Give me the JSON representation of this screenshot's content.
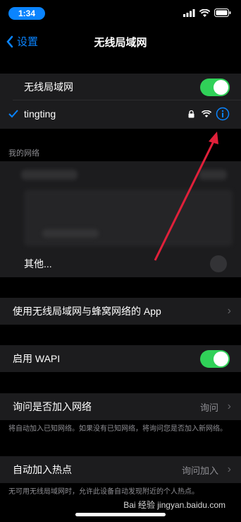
{
  "status_bar": {
    "time": "1:34"
  },
  "nav": {
    "back_label": "设置",
    "title": "无线局域网"
  },
  "wifi_group": {
    "toggle_label": "无线局域网",
    "connected_network": "tingting"
  },
  "my_networks": {
    "header": "我的网络",
    "other_label": "其他..."
  },
  "apps_row": {
    "label": "使用无线局域网与蜂窝网络的 App"
  },
  "wapi_row": {
    "label": "启用 WAPI"
  },
  "ask_join": {
    "label": "询问是否加入网络",
    "value": "询问",
    "footnote": "将自动加入已知网络。如果没有已知网络，将询问您是否加入新网络。"
  },
  "hotspot": {
    "label": "自动加入热点",
    "value": "询问加入",
    "footnote": "无可用无线局域网时，允许此设备自动发现附近的个人热点。"
  },
  "watermark": "Bai 经验 jingyan.baidu.com",
  "colors": {
    "accent": "#0a84ff",
    "toggle_on": "#30d158",
    "arrow": "#e0203a"
  }
}
